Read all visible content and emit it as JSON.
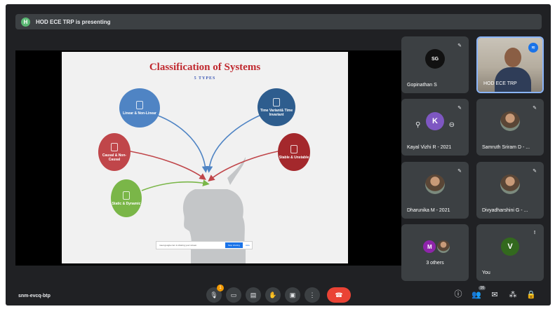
{
  "presenting": {
    "avatar_letter": "H",
    "text": "HOD ECE TRP is presenting"
  },
  "slide": {
    "title": "Classification of Systems",
    "subtitle": "5 TYPES",
    "nodes": {
      "linear": "Linear & Non-Linear",
      "time": "Time Variant& Time Invariant",
      "causal": "Causal & Non-Causal",
      "stable": "Stable & Unstable",
      "static": "Static & Dynamic"
    },
    "banner": {
      "text": "meet.google.com is sharing your screen.",
      "stop_label": "Stop sharing",
      "hide_label": "Hide"
    }
  },
  "participants": [
    {
      "name": "Gopinathan S",
      "avatar": "SG"
    },
    {
      "name": "HOD ECE TRP"
    },
    {
      "name": "Kayal Vizhi R - 2021",
      "avatar": "K"
    },
    {
      "name": "Samruth Sriram D - ..."
    },
    {
      "name": "Dharunika M - 2021"
    },
    {
      "name": "Divyadharshini G - ..."
    },
    {
      "name": "3 others",
      "avatar": "M"
    },
    {
      "name": "You",
      "avatar": "V"
    }
  ],
  "bottom": {
    "meeting_code": "snm-evcq-btp",
    "mic_badge": "1",
    "people_count": "16"
  },
  "colors": {
    "linear": "#4f84c4",
    "time": "#2e5d8e",
    "causal": "#c0464a",
    "stable": "#a4282c",
    "static": "#7ab648",
    "end_call": "#ea4335"
  },
  "icons": {
    "mic": "mic-icon",
    "camera": "camera-icon",
    "captions": "captions-icon",
    "hand": "raise-hand-icon",
    "present": "present-icon",
    "more": "more-options-icon",
    "end": "end-call-icon",
    "info": "info-icon",
    "people": "people-icon",
    "chat": "chat-icon",
    "activities": "activities-icon",
    "lock": "host-controls-icon"
  }
}
